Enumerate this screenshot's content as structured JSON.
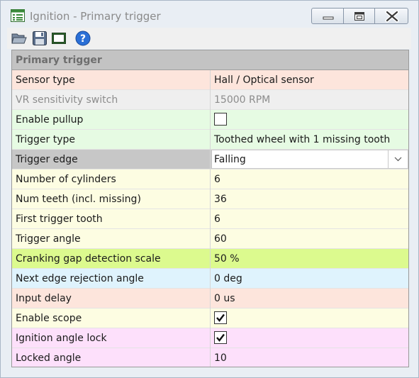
{
  "window": {
    "title": "Ignition - Primary trigger"
  },
  "toolbar": {
    "icons": [
      "open-folder-icon",
      "save-icon",
      "panel-icon",
      "help-icon"
    ]
  },
  "grid": {
    "header": "Primary trigger",
    "rows": [
      {
        "name": "Sensor type",
        "value": "Hall / Optical sensor",
        "bg": "#fde5dc",
        "kind": "text"
      },
      {
        "name": "VR sensitivity switch",
        "value": "15000 RPM",
        "bg": "#efefef",
        "kind": "text",
        "disabled": true
      },
      {
        "name": "Enable pullup",
        "value": "",
        "bg": "#e6fbe3",
        "kind": "checkbox",
        "checked": false
      },
      {
        "name": "Trigger type",
        "value": "Toothed wheel with 1 missing tooth",
        "bg": "#e6fbe3",
        "kind": "text"
      },
      {
        "name": "Trigger edge",
        "value": "Falling",
        "bg": "#c7c7c7",
        "kind": "dropdown"
      },
      {
        "name": "Number of cylinders",
        "value": "6",
        "bg": "#fdfde2",
        "kind": "text"
      },
      {
        "name": "Num teeth (incl. missing)",
        "value": "36",
        "bg": "#fdfde2",
        "kind": "text"
      },
      {
        "name": "First trigger tooth",
        "value": "6",
        "bg": "#fdfde2",
        "kind": "text"
      },
      {
        "name": "Trigger angle",
        "value": "60",
        "bg": "#fdfde2",
        "kind": "text"
      },
      {
        "name": "Cranking gap detection scale",
        "value": "50 %",
        "bg": "#dcfa8e",
        "kind": "text"
      },
      {
        "name": "Next edge rejection angle",
        "value": "0 deg",
        "bg": "#dff3fd",
        "kind": "text"
      },
      {
        "name": "Input delay",
        "value": "0 us",
        "bg": "#fde5dc",
        "kind": "text"
      },
      {
        "name": "Enable scope",
        "value": "",
        "bg": "#fdfde2",
        "kind": "checkbox",
        "checked": true
      },
      {
        "name": "Ignition angle lock",
        "value": "",
        "bg": "#fde0fb",
        "kind": "checkbox",
        "checked": true
      },
      {
        "name": "Locked angle",
        "value": "10",
        "bg": "#fde0fb",
        "kind": "text"
      }
    ]
  }
}
